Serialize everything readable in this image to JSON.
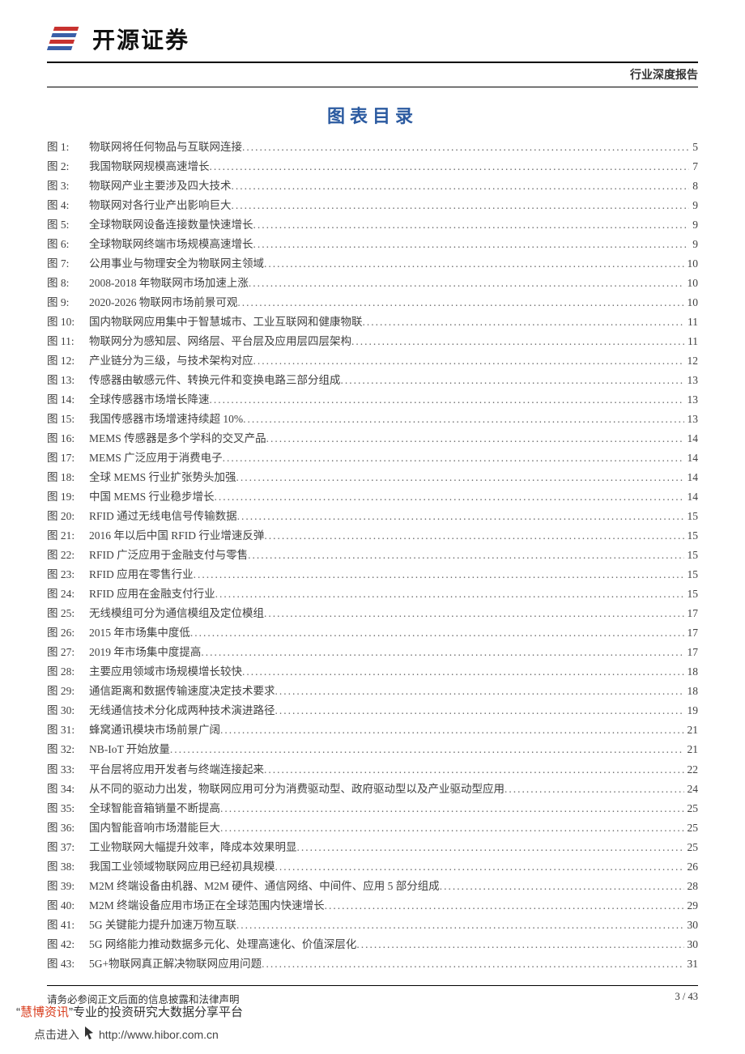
{
  "header": {
    "company": "开源证券",
    "report_type": "行业深度报告"
  },
  "toc": {
    "title": "图表目录",
    "label_prefix": "图 ",
    "items": [
      {
        "n": "1:",
        "t": "物联网将任何物品与互联网连接",
        "p": "5"
      },
      {
        "n": "2:",
        "t": "我国物联网规模高速增长",
        "p": "7"
      },
      {
        "n": "3:",
        "t": "物联网产业主要涉及四大技术",
        "p": "8"
      },
      {
        "n": "4:",
        "t": "物联网对各行业产出影响巨大",
        "p": "9"
      },
      {
        "n": "5:",
        "t": "全球物联网设备连接数量快速增长",
        "p": "9"
      },
      {
        "n": "6:",
        "t": "全球物联网终端市场规模高速增长",
        "p": "9"
      },
      {
        "n": "7:",
        "t": "公用事业与物理安全为物联网主领域",
        "p": "10"
      },
      {
        "n": "8:",
        "t": "2008-2018 年物联网市场加速上涨",
        "p": "10"
      },
      {
        "n": "9:",
        "t": "2020-2026 物联网市场前景可观",
        "p": "10"
      },
      {
        "n": "10:",
        "t": "国内物联网应用集中于智慧城市、工业互联网和健康物联",
        "p": "11"
      },
      {
        "n": "11:",
        "t": "物联网分为感知层、网络层、平台层及应用层四层架构",
        "p": "11"
      },
      {
        "n": "12:",
        "t": "产业链分为三级，与技术架构对应",
        "p": "12"
      },
      {
        "n": "13:",
        "t": "传感器由敏感元件、转换元件和变换电路三部分组成",
        "p": "13"
      },
      {
        "n": "14:",
        "t": "全球传感器市场增长降速",
        "p": "13"
      },
      {
        "n": "15:",
        "t": "我国传感器市场增速持续超 10%",
        "p": "13"
      },
      {
        "n": "16:",
        "t": "MEMS 传感器是多个学科的交叉产品",
        "p": "14"
      },
      {
        "n": "17:",
        "t": "MEMS 广泛应用于消费电子",
        "p": "14"
      },
      {
        "n": "18:",
        "t": "全球 MEMS 行业扩张势头加强",
        "p": "14"
      },
      {
        "n": "19:",
        "t": "中国 MEMS 行业稳步增长",
        "p": "14"
      },
      {
        "n": "20:",
        "t": "RFID 通过无线电信号传输数据",
        "p": "15"
      },
      {
        "n": "21:",
        "t": "2016 年以后中国 RFID 行业增速反弹",
        "p": "15"
      },
      {
        "n": "22:",
        "t": "RFID 广泛应用于金融支付与零售",
        "p": "15"
      },
      {
        "n": "23:",
        "t": "RFID 应用在零售行业",
        "p": "15"
      },
      {
        "n": "24:",
        "t": "RFID 应用在金融支付行业",
        "p": "15"
      },
      {
        "n": "25:",
        "t": "无线模组可分为通信模组及定位模组",
        "p": "17"
      },
      {
        "n": "26:",
        "t": "2015 年市场集中度低",
        "p": "17"
      },
      {
        "n": "27:",
        "t": "2019 年市场集中度提高",
        "p": "17"
      },
      {
        "n": "28:",
        "t": "主要应用领域市场规模增长较快",
        "p": "18"
      },
      {
        "n": "29:",
        "t": "通信距离和数据传输速度决定技术要求",
        "p": "18"
      },
      {
        "n": "30:",
        "t": "无线通信技术分化成两种技术演进路径",
        "p": "19"
      },
      {
        "n": "31:",
        "t": "蜂窝通讯模块市场前景广阔",
        "p": "21"
      },
      {
        "n": "32:",
        "t": "NB-IoT 开始放量",
        "p": "21"
      },
      {
        "n": "33:",
        "t": "平台层将应用开发者与终端连接起来",
        "p": "22"
      },
      {
        "n": "34:",
        "t": "从不同的驱动力出发，物联网应用可分为消费驱动型、政府驱动型以及产业驱动型应用",
        "p": "24"
      },
      {
        "n": "35:",
        "t": "全球智能音箱销量不断提高",
        "p": "25"
      },
      {
        "n": "36:",
        "t": "国内智能音响市场潜能巨大",
        "p": "25"
      },
      {
        "n": "37:",
        "t": "工业物联网大幅提升效率，降成本效果明显",
        "p": "25"
      },
      {
        "n": "38:",
        "t": "我国工业领域物联网应用已经初具规模",
        "p": "26"
      },
      {
        "n": "39:",
        "t": "M2M 终端设备由机器、M2M 硬件、通信网络、中间件、应用 5 部分组成",
        "p": "28"
      },
      {
        "n": "40:",
        "t": "M2M 终端设备应用市场正在全球范围内快速增长",
        "p": "29"
      },
      {
        "n": "41:",
        "t": "5G 关键能力提升加速万物互联",
        "p": "30"
      },
      {
        "n": "42:",
        "t": "5G 网络能力推动数据多元化、处理高速化、价值深层化",
        "p": "30"
      },
      {
        "n": "43:",
        "t": "5G+物联网真正解决物联网应用问题",
        "p": "31"
      }
    ]
  },
  "footer": {
    "disclaimer": "请务必参阅正文后面的信息披露和法律声明",
    "page": "3 / 43"
  },
  "promo": {
    "q1": "“",
    "brand": "慧博资讯",
    "q2": "”",
    "tag": "专业的投资研究大数据分享平台",
    "cta": "点击进入",
    "url": "http://www.hibor.com.cn"
  }
}
